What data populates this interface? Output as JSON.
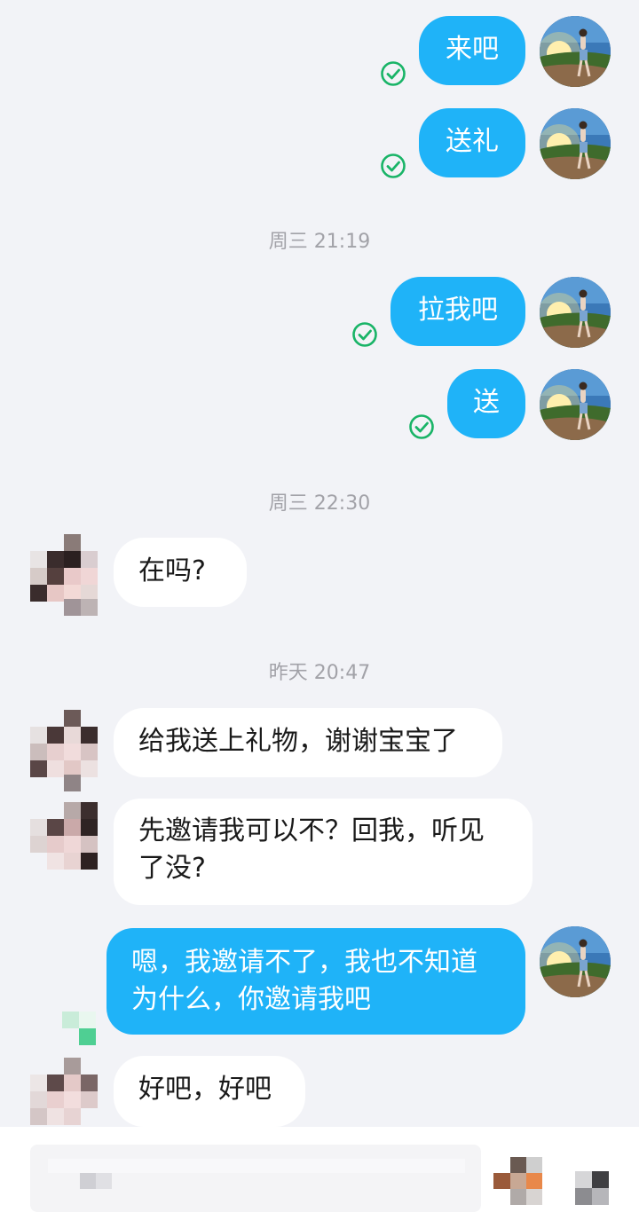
{
  "colors": {
    "background": "#f2f3f7",
    "outgoing_bubble": "#1fb3f8",
    "incoming_bubble": "#ffffff",
    "read_check": "#19b467",
    "timestamp": "#a2a2a8"
  },
  "messages": [
    {
      "direction": "out",
      "text": "来吧",
      "status": "read-check-icon"
    },
    {
      "direction": "out",
      "text": "送礼",
      "status": "read-check-icon"
    },
    {
      "type": "timestamp",
      "text": "周三 21:19"
    },
    {
      "direction": "out",
      "text": "拉我吧",
      "status": "read-check-icon"
    },
    {
      "direction": "out",
      "text": "送",
      "status": "read-check-icon"
    },
    {
      "type": "timestamp",
      "text": "周三 22:30"
    },
    {
      "direction": "in",
      "text": "在吗?"
    },
    {
      "type": "timestamp",
      "text": "昨天 20:47"
    },
    {
      "direction": "in",
      "text": "给我送上礼物，谢谢宝宝了"
    },
    {
      "direction": "in",
      "text": "先邀请我可以不？回我，听见了没?"
    },
    {
      "direction": "out",
      "text": "嗯，我邀请不了，我也不知道为什么，你邀请我吧",
      "status": "sending-icon"
    },
    {
      "direction": "in",
      "text": "好吧，好吧"
    }
  ],
  "input_bar": {
    "placeholder": "",
    "icons": [
      "pixelated-avatar-icon",
      "pixelated-more-icon"
    ]
  }
}
